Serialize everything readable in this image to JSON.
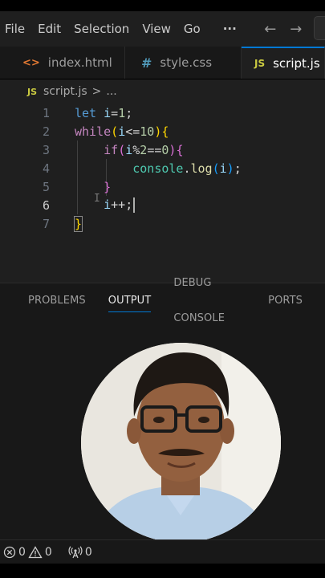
{
  "menu": {
    "items": [
      "File",
      "Edit",
      "Selection",
      "View",
      "Go"
    ],
    "more": "···",
    "back_arrow": "←",
    "forward_arrow": "→"
  },
  "tabs": [
    {
      "icon": "<>",
      "label": "index.html"
    },
    {
      "icon": "#",
      "label": "style.css"
    },
    {
      "icon": "JS",
      "label": "script.js"
    }
  ],
  "breadcrumb": {
    "badge": "JS",
    "file": "script.js",
    "separator": ">",
    "more": "..."
  },
  "editor": {
    "line_numbers": [
      "1",
      "2",
      "3",
      "4",
      "5",
      "6",
      "7"
    ],
    "active_line": "6",
    "lines": [
      "let i=1;",
      "while(i<=10){",
      "    if(i%2==0){",
      "        console.log(i);",
      "    }",
      "    i++;",
      "}"
    ]
  },
  "panel": {
    "tabs": [
      "PROBLEMS",
      "OUTPUT",
      "DEBUG CONSOLE",
      "PORTS"
    ],
    "active_tab": "OUTPUT"
  },
  "status": {
    "errors": "0",
    "warnings": "0",
    "ports": "0"
  },
  "colors": {
    "accent": "#0078d4",
    "editor_bg": "#1f1f1f",
    "panel_bg": "#181818",
    "js_yellow": "#cbcb41",
    "html_orange": "#e37933",
    "css_blue": "#519aba"
  }
}
